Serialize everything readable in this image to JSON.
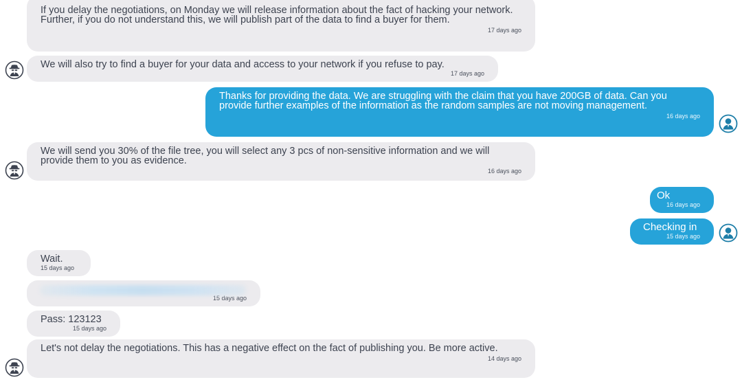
{
  "messages": [
    {
      "text": "If you delay the negotiations, on Monday we will release information about the fact of hacking your network. Further, if you do not understand this, we will publish part of the data to find a buyer for them.",
      "time": "17 days ago"
    },
    {
      "text": "We will also try to find a buyer for your data and access to your network if you refuse to pay.",
      "time": "17 days ago"
    },
    {
      "text": "Thanks for providing the data.  We are struggling with the claim that you have 200GB of data.  Can you provide further examples of the information as the random samples are not moving management.",
      "time": "16 days ago"
    },
    {
      "text": "We will send you 30% of the file tree, you will select any 3 pcs of non-sensitive information and we will provide them to you as evidence.",
      "time": "16 days ago"
    },
    {
      "text": "Ok",
      "time": "16 days ago"
    },
    {
      "text": "Checking in",
      "time": "15 days ago"
    },
    {
      "text": "Wait.",
      "time": "15 days ago"
    },
    {
      "text": "",
      "time": "15 days ago"
    },
    {
      "text": "Pass: 123123",
      "time": "15 days ago"
    },
    {
      "text": "Let's not delay the negotiations. This has a negative effect on the fact of publishing you. Be more active.",
      "time": "14 days ago"
    }
  ],
  "icons": {
    "attacker": "hacker-spy-icon",
    "victim": "user-person-icon"
  },
  "colors": {
    "incoming_bubble": "#ecebee",
    "outgoing_bubble": "#26a3d9",
    "incoming_text": "#3d4350",
    "avatar_stroke": "#1d7ea8"
  }
}
